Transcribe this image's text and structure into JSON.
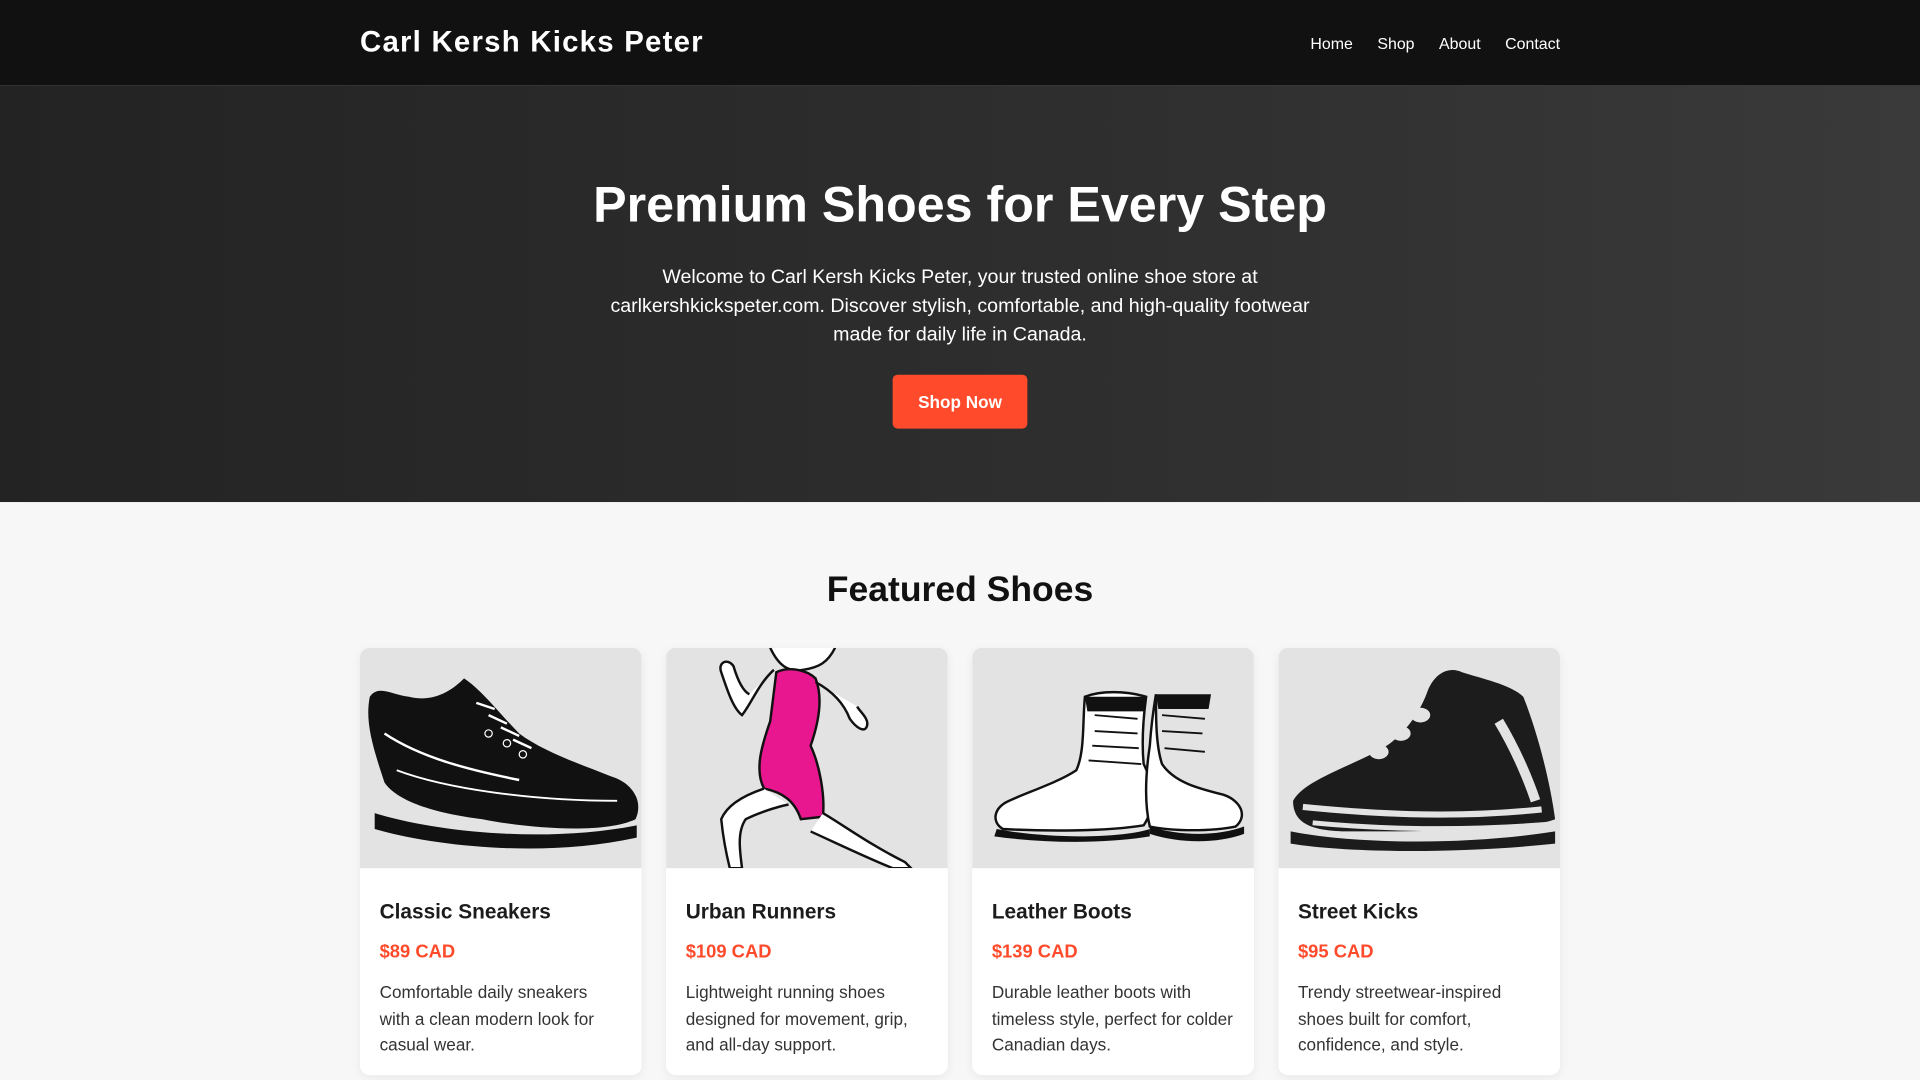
{
  "header": {
    "brand": "Carl Kersh Kicks Peter",
    "nav": [
      "Home",
      "Shop",
      "About",
      "Contact"
    ]
  },
  "hero": {
    "title": "Premium Shoes for Every Step",
    "text": "Welcome to Carl Kersh Kicks Peter, your trusted online shoe store at carlkershkickspeter.com. Discover stylish, comfortable, and high-quality footwear made for daily life in Canada.",
    "cta": "Shop Now"
  },
  "featured": {
    "title": "Featured Shoes",
    "products": [
      {
        "name": "Classic Sneakers",
        "price": "$89 CAD",
        "desc": "Comfortable daily sneakers with a clean modern look for casual wear.",
        "icon": "sneaker-icon"
      },
      {
        "name": "Urban Runners",
        "price": "$109 CAD",
        "desc": "Lightweight running shoes designed for movement, grip, and all-day support.",
        "icon": "runner-icon"
      },
      {
        "name": "Leather Boots",
        "price": "$139 CAD",
        "desc": "Durable leather boots with timeless style, perfect for colder Canadian days.",
        "icon": "boots-icon"
      },
      {
        "name": "Street Kicks",
        "price": "$95 CAD",
        "desc": "Trendy streetwear-inspired shoes built for comfort, confidence, and style.",
        "icon": "street-shoe-icon"
      }
    ]
  },
  "colors": {
    "accent": "#ff4b2b",
    "header": "#111111",
    "hero": "#2f2f2f",
    "runner_suit": "#e8168f"
  }
}
